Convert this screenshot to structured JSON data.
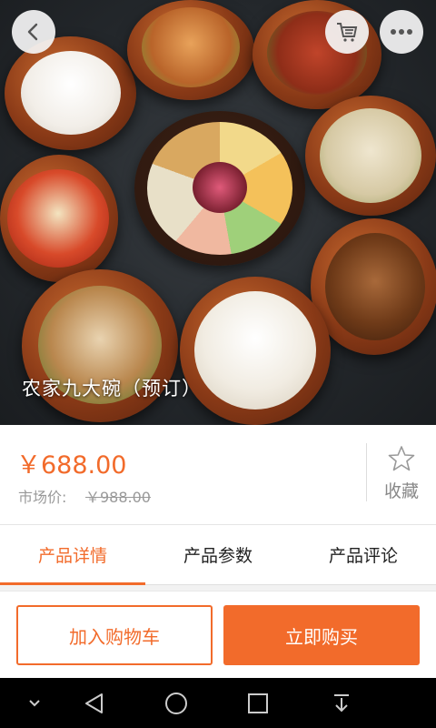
{
  "hero": {
    "title": "农家九大碗（预订）",
    "back_icon": "chevron-left-icon",
    "cart_icon": "cart-list-icon",
    "more_icon": "more-dots-icon"
  },
  "price": {
    "current": "￥688.00",
    "market_label": "市场价:",
    "market_value": "￥988.00",
    "accent_color": "#f26b2b"
  },
  "favorite": {
    "label": "收藏",
    "icon": "star-outline-icon"
  },
  "tabs": [
    {
      "label": "产品详情",
      "active": true
    },
    {
      "label": "产品参数",
      "active": false
    },
    {
      "label": "产品评论",
      "active": false
    }
  ],
  "actions": {
    "add_to_cart": "加入购物车",
    "buy_now": "立即购买"
  },
  "system_nav": {
    "icons": [
      "chevron-down-icon",
      "back-triangle-icon",
      "home-circle-icon",
      "recents-square-icon",
      "notification-pull-icon"
    ]
  }
}
